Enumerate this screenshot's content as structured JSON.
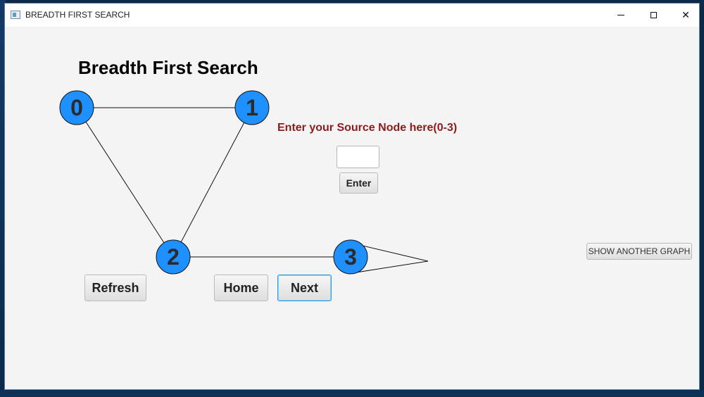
{
  "window": {
    "title": "BREADTH FIRST SEARCH",
    "controls": {
      "minimize": "minimize",
      "maximize": "maximize",
      "close": "close"
    }
  },
  "main": {
    "heading": "Breadth First Search",
    "prompt": "Enter your Source Node here(0-3)",
    "source_input": {
      "value": "",
      "placeholder": ""
    },
    "enter_label": "Enter",
    "refresh_label": "Refresh",
    "home_label": "Home",
    "next_label": "Next",
    "show_another_label": "SHOW ANOTHER GRAPH"
  },
  "graph": {
    "node_color": "#1e90ff",
    "nodes": [
      {
        "id": "0",
        "label": "0"
      },
      {
        "id": "1",
        "label": "1"
      },
      {
        "id": "2",
        "label": "2"
      },
      {
        "id": "3",
        "label": "3"
      }
    ],
    "edges": [
      {
        "from": "0",
        "to": "1"
      },
      {
        "from": "0",
        "to": "2"
      },
      {
        "from": "1",
        "to": "2"
      },
      {
        "from": "2",
        "to": "3"
      },
      {
        "from": "3",
        "to": "3",
        "type": "self-loop"
      }
    ]
  },
  "colors": {
    "prompt": "#8b1c1c",
    "next_focus_border": "#2b9de0",
    "window_bg": "#f4f4f4"
  }
}
